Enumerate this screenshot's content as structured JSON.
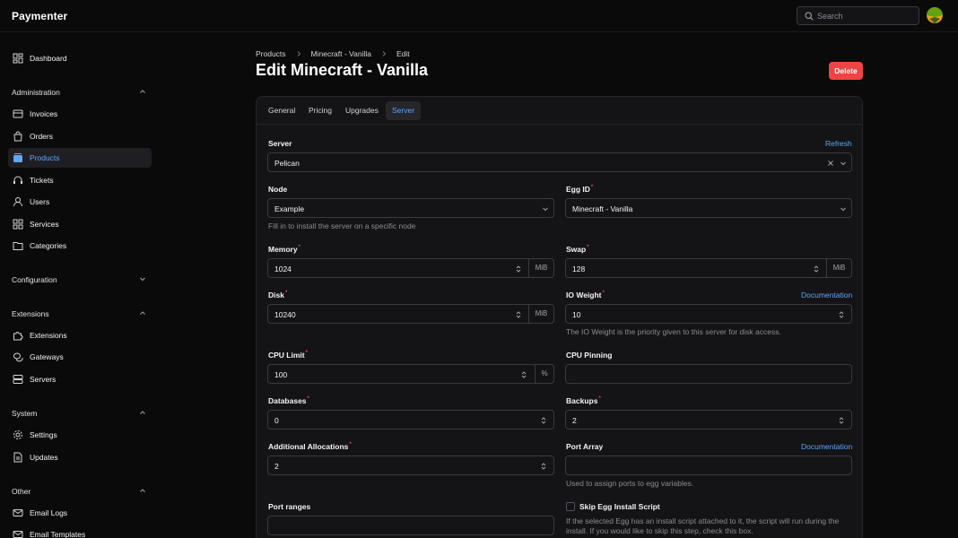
{
  "app": {
    "brand": "Paymenter"
  },
  "search": {
    "placeholder": "Search"
  },
  "sidebar": {
    "dashboard": "Dashboard",
    "groups": {
      "administration": "Administration",
      "configuration": "Configuration",
      "extensions": "Extensions",
      "system": "System",
      "other": "Other"
    },
    "items": {
      "invoices": "Invoices",
      "orders": "Orders",
      "products": "Products",
      "tickets": "Tickets",
      "users": "Users",
      "services": "Services",
      "categories": "Categories",
      "extensions": "Extensions",
      "gateways": "Gateways",
      "servers": "Servers",
      "settings": "Settings",
      "updates": "Updates",
      "email_logs": "Email Logs",
      "email_templates": "Email Templates"
    }
  },
  "breadcrumb": [
    "Products",
    "Minecraft - Vanilla",
    "Edit"
  ],
  "page": {
    "title": "Edit Minecraft - Vanilla",
    "delete_label": "Delete"
  },
  "tabs": [
    "General",
    "Pricing",
    "Upgrades",
    "Server"
  ],
  "form": {
    "server": {
      "label": "Server",
      "value": "Pelican",
      "refresh": "Refresh"
    },
    "node": {
      "label": "Node",
      "value": "Example",
      "help": "Fill in to install the server on a specific node"
    },
    "egg": {
      "label": "Egg ID",
      "value": "Minecraft - Vanilla"
    },
    "memory": {
      "label": "Memory",
      "value": "1024",
      "unit": "MiB"
    },
    "swap": {
      "label": "Swap",
      "value": "128",
      "unit": "MiB"
    },
    "disk": {
      "label": "Disk",
      "value": "10240",
      "unit": "MiB"
    },
    "io": {
      "label": "IO Weight",
      "value": "10",
      "doc": "Documentation",
      "help": "The IO Weight is the priority given to this server for disk access."
    },
    "cpu_limit": {
      "label": "CPU Limit",
      "value": "100",
      "unit": "%"
    },
    "cpu_pinning": {
      "label": "CPU Pinning",
      "value": ""
    },
    "databases": {
      "label": "Databases",
      "value": "0"
    },
    "backups": {
      "label": "Backups",
      "value": "2"
    },
    "allocations": {
      "label": "Additional Allocations",
      "value": "2"
    },
    "port_array": {
      "label": "Port Array",
      "value": "",
      "doc": "Documentation",
      "help": "Used to assign ports to egg variables."
    },
    "port_ranges": {
      "label": "Port ranges",
      "value": ""
    },
    "skip_install": {
      "label": "Skip Egg Install Script",
      "checked": false,
      "help_line1": "If the selected Egg has an install script attached to it, the script will run during the",
      "help_line2": "install. If you would like to skip this step, check this box."
    }
  },
  "colors": {
    "accent": "#60a5fa",
    "danger": "#ef4444",
    "background": "#0a0a0b",
    "card": "#141416"
  }
}
